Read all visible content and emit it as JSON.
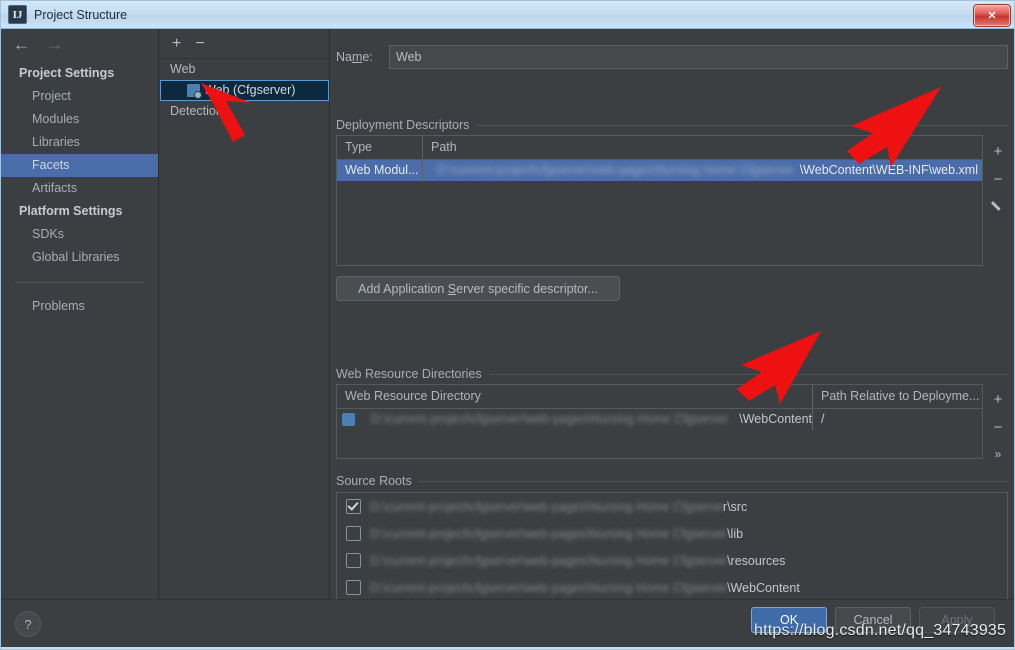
{
  "window": {
    "title": "Project Structure",
    "app_icon": "intellij-idea-icon",
    "close_label": "✕"
  },
  "nav": {
    "back_icon": "arrow-left-icon",
    "forward_icon": "arrow-right-icon"
  },
  "sidebar": {
    "groups": [
      {
        "label": "Project Settings",
        "items": [
          {
            "label": "Project",
            "selected": false
          },
          {
            "label": "Modules",
            "selected": false
          },
          {
            "label": "Libraries",
            "selected": false
          },
          {
            "label": "Facets",
            "selected": true
          },
          {
            "label": "Artifacts",
            "selected": false
          }
        ]
      },
      {
        "label": "Platform Settings",
        "items": [
          {
            "label": "SDKs",
            "selected": false
          },
          {
            "label": "Global Libraries",
            "selected": false
          }
        ]
      }
    ],
    "footer_items": [
      {
        "label": "Problems",
        "selected": false
      }
    ]
  },
  "tree": {
    "toolbar": {
      "add": "+",
      "remove": "−"
    },
    "nodes": [
      {
        "label": "Web",
        "child": false,
        "selected": false,
        "icon": ""
      },
      {
        "label": "Web (Cfgserver)",
        "child": true,
        "selected": true,
        "icon": "web-facet-icon"
      },
      {
        "label": "Detection",
        "child": false,
        "selected": false,
        "icon": ""
      }
    ]
  },
  "facet": {
    "name_label": "Name:",
    "name_label_mnemonic": "m",
    "name_value": "Web",
    "deployment": {
      "title": "Deployment Descriptors",
      "columns": [
        "Type",
        "Path"
      ],
      "rows": [
        {
          "type": "Web Modul...",
          "path_blurred": "D:\\current-project\\cfgserver\\web-pages\\Nursing Home Cfgserver",
          "path_visible": "\\WebContent\\WEB-INF\\web.xml",
          "selected": true
        }
      ],
      "tools": [
        "add-icon",
        "remove-icon",
        "edit-icon"
      ],
      "add_descriptor_button": "Add Application Server specific descriptor...",
      "add_descriptor_mnemonic": "S"
    },
    "web_resources": {
      "title": "Web Resource Directories",
      "columns": [
        "Web Resource Directory",
        "Path Relative to Deployme..."
      ],
      "rows": [
        {
          "dir_blurred": "D:\\current-project\\cfgserver\\web-pages\\Nursing Home Cfgserver",
          "dir_visible": "\\WebContent",
          "relative_path": "/",
          "icon": "folder-icon"
        }
      ],
      "tools": [
        "add-icon",
        "remove-icon",
        "expand-icon"
      ]
    },
    "source_roots": {
      "title": "Source Roots",
      "rows": [
        {
          "path_blurred": "D:\\current-project\\cfgserver\\web-pages\\Nursing Home Cfgserve",
          "path_visible": "r\\src",
          "checked": true
        },
        {
          "path_blurred": "D:\\current-project\\cfgserver\\web-pages\\Nursing Home Cfgserver",
          "path_visible": "\\lib",
          "checked": false
        },
        {
          "path_blurred": "D:\\current-project\\cfgserver\\web-pages\\Nursing Home Cfgserver",
          "path_visible": "\\resources",
          "checked": false
        },
        {
          "path_blurred": "D:\\current-project\\cfgserver\\web-pages\\Nursing Home Cfgserver",
          "path_visible": "\\WebContent",
          "checked": false
        }
      ]
    }
  },
  "footer": {
    "help_icon": "?",
    "ok_label": "OK",
    "cancel_label": "Cancel",
    "apply_label": "Apply"
  },
  "watermark": "https://blog.csdn.net/qq_34743935",
  "colors": {
    "accent_selection": "#4a6ca8",
    "tree_selection": "#0d293e",
    "tree_selection_border": "#5b9bd5",
    "window_bg": "#3c3f41",
    "titlebar": "#c6ddf0",
    "ok_button": "#3f6ba8",
    "annotation_arrow": "#ee1111",
    "close_button": "#c9332c"
  }
}
